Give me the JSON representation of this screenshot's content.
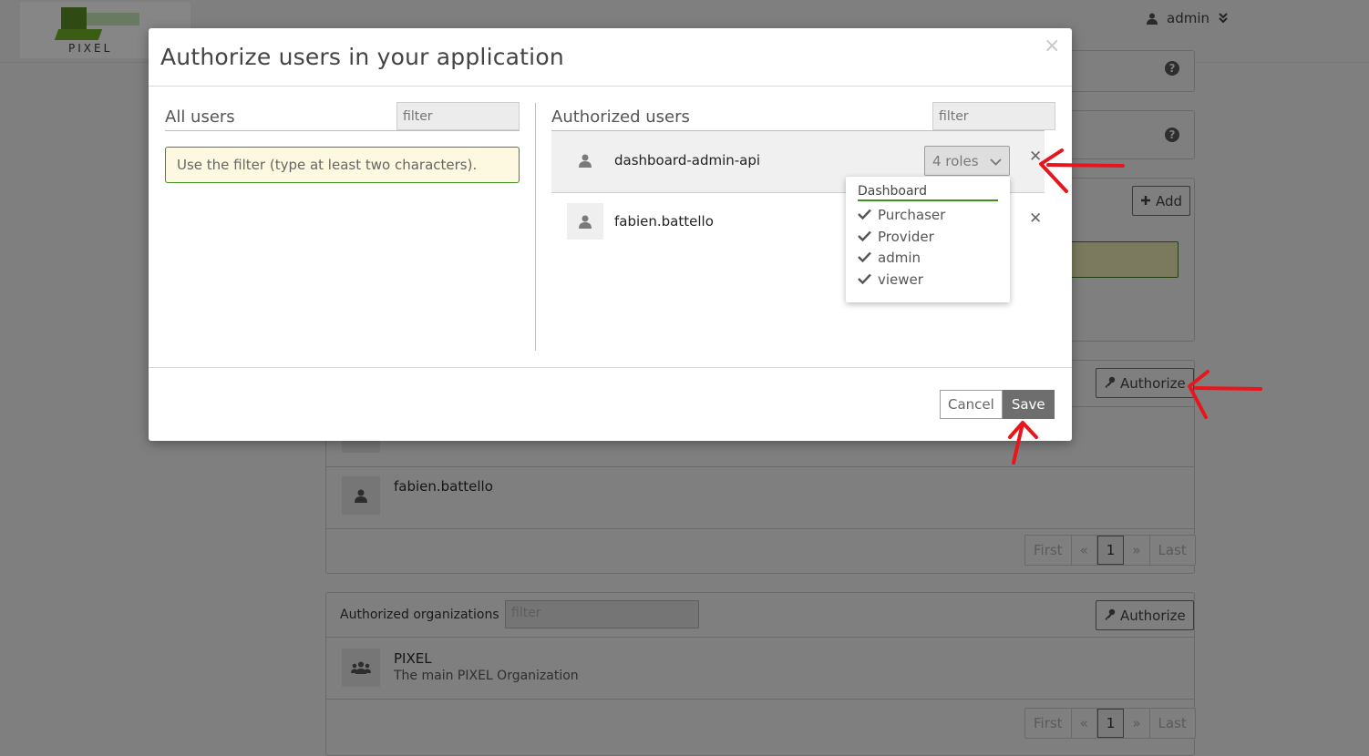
{
  "header": {
    "logo_text": "PIXEL",
    "user_label": "admin"
  },
  "background": {
    "add_button": "Add",
    "authorize_button": "Authorize",
    "users": [
      "fabien.battello"
    ],
    "pagination": [
      "First",
      "«",
      "1",
      "»",
      "Last"
    ],
    "orgs_panel": {
      "title": "Authorized organizations",
      "filter_placeholder": "filter",
      "authorize_button": "Authorize",
      "org_name": "PIXEL",
      "org_desc": "The main PIXEL Organization"
    }
  },
  "modal": {
    "title": "Authorize users in your application",
    "close": "×",
    "all_users": {
      "title": "All users",
      "filter_placeholder": "filter",
      "hint": "Use the filter (type at least two characters)."
    },
    "authorized_users": {
      "title": "Authorized users",
      "filter_placeholder": "filter",
      "users": [
        {
          "name": "dashboard-admin-api",
          "roles_label": "4 roles"
        },
        {
          "name": "fabien.battello"
        }
      ]
    },
    "roles_dropdown": {
      "group": "Dashboard",
      "roles": [
        "Purchaser",
        "Provider",
        "admin",
        "viewer"
      ]
    },
    "footer": {
      "cancel": "Cancel",
      "save": "Save"
    }
  },
  "colors": {
    "accent_green": "#3f8f1c",
    "annotation_red": "#e8161c",
    "overlay": "#7f7f7f"
  }
}
